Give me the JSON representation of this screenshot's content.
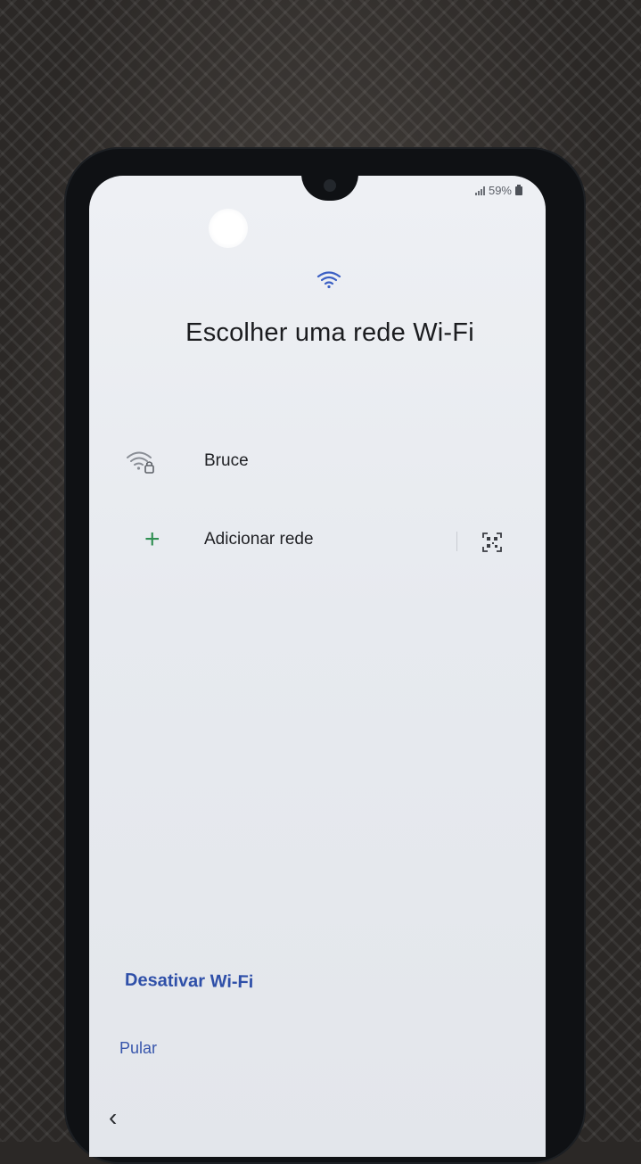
{
  "status_bar": {
    "battery_percent": "59%",
    "signal_icon": "signal-icon",
    "battery_icon": "battery-icon"
  },
  "header": {
    "icon": "wifi-icon",
    "title": "Escolher uma rede Wi-Fi"
  },
  "networks": [
    {
      "icon": "wifi-lock-icon",
      "label": "Bruce"
    }
  ],
  "add_network": {
    "icon": "plus-icon",
    "label": "Adicionar rede",
    "scan_icon": "qr-code-scan-icon"
  },
  "actions": {
    "disable_wifi": "Desativar Wi-Fi",
    "skip": "Pular"
  },
  "navigation": {
    "back_icon": "back-icon"
  },
  "colors": {
    "accent_link": "#2e4fa8",
    "add_icon": "#2f8f52",
    "wifi_icon": "#3b5fc4"
  }
}
